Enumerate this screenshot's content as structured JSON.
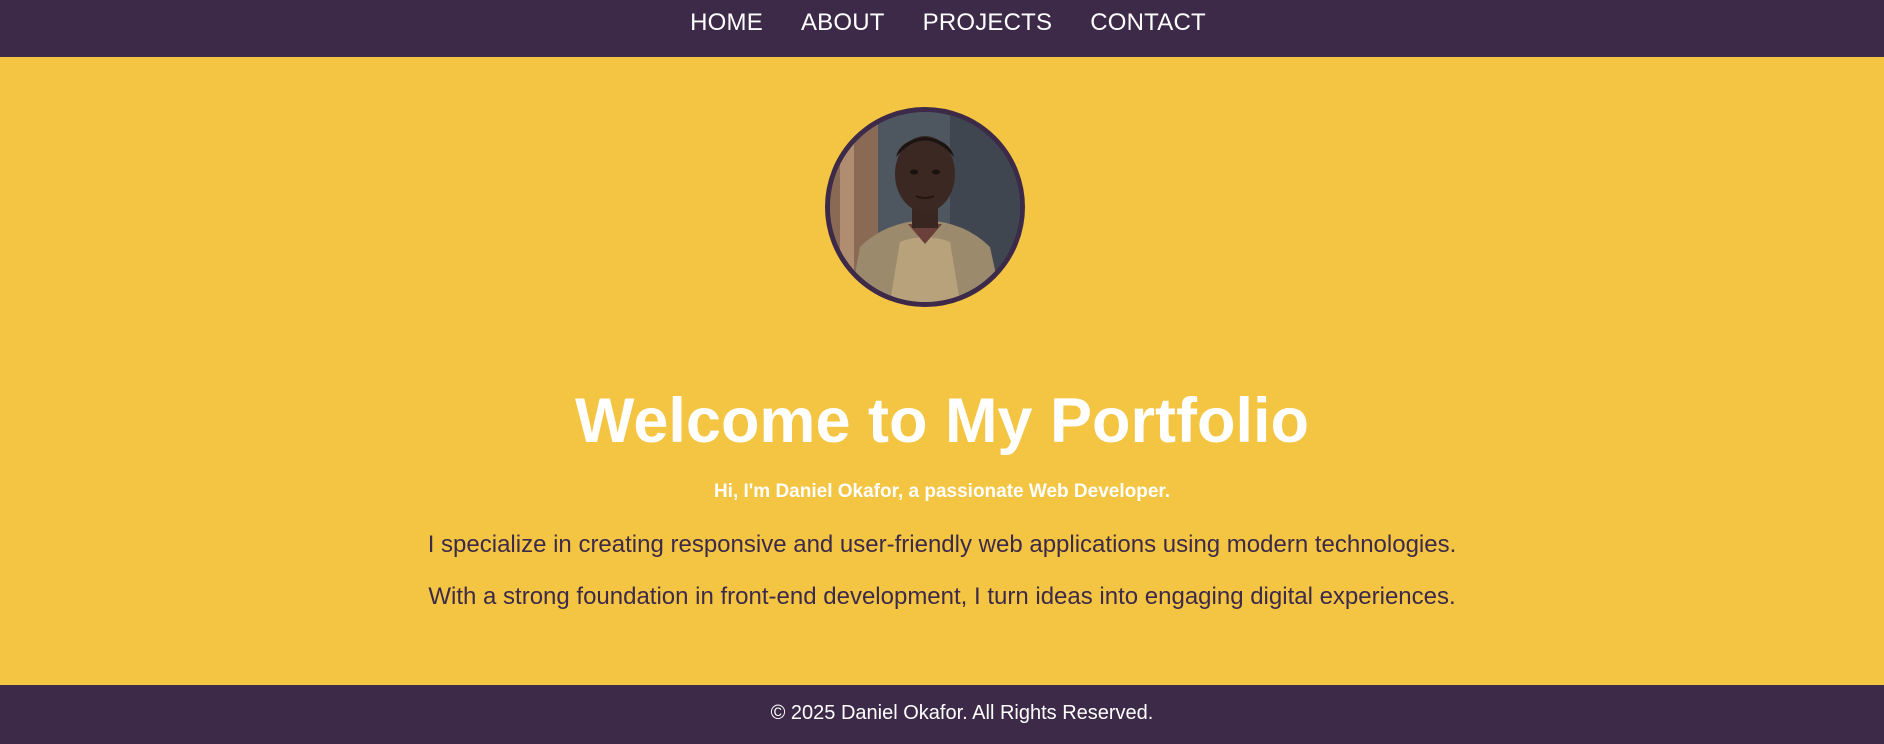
{
  "colors": {
    "brand_dark": "#3D2A48",
    "background": "#F4C542",
    "text_light": "#FFFFFF"
  },
  "nav": {
    "items": [
      {
        "label": "HOME"
      },
      {
        "label": "ABOUT"
      },
      {
        "label": "PROJECTS"
      },
      {
        "label": "CONTACT"
      }
    ]
  },
  "hero": {
    "avatar": "profile-photo",
    "title": "Welcome to My Portfolio",
    "subtitle": "Hi, I'm Daniel Okafor, a passionate Web Developer.",
    "paragraphs": [
      "I specialize in creating responsive and user-friendly web applications using modern technologies.",
      "With a strong foundation in front-end development, I turn ideas into engaging digital experiences."
    ]
  },
  "footer": {
    "text": "© 2025 Daniel Okafor. All Rights Reserved."
  }
}
